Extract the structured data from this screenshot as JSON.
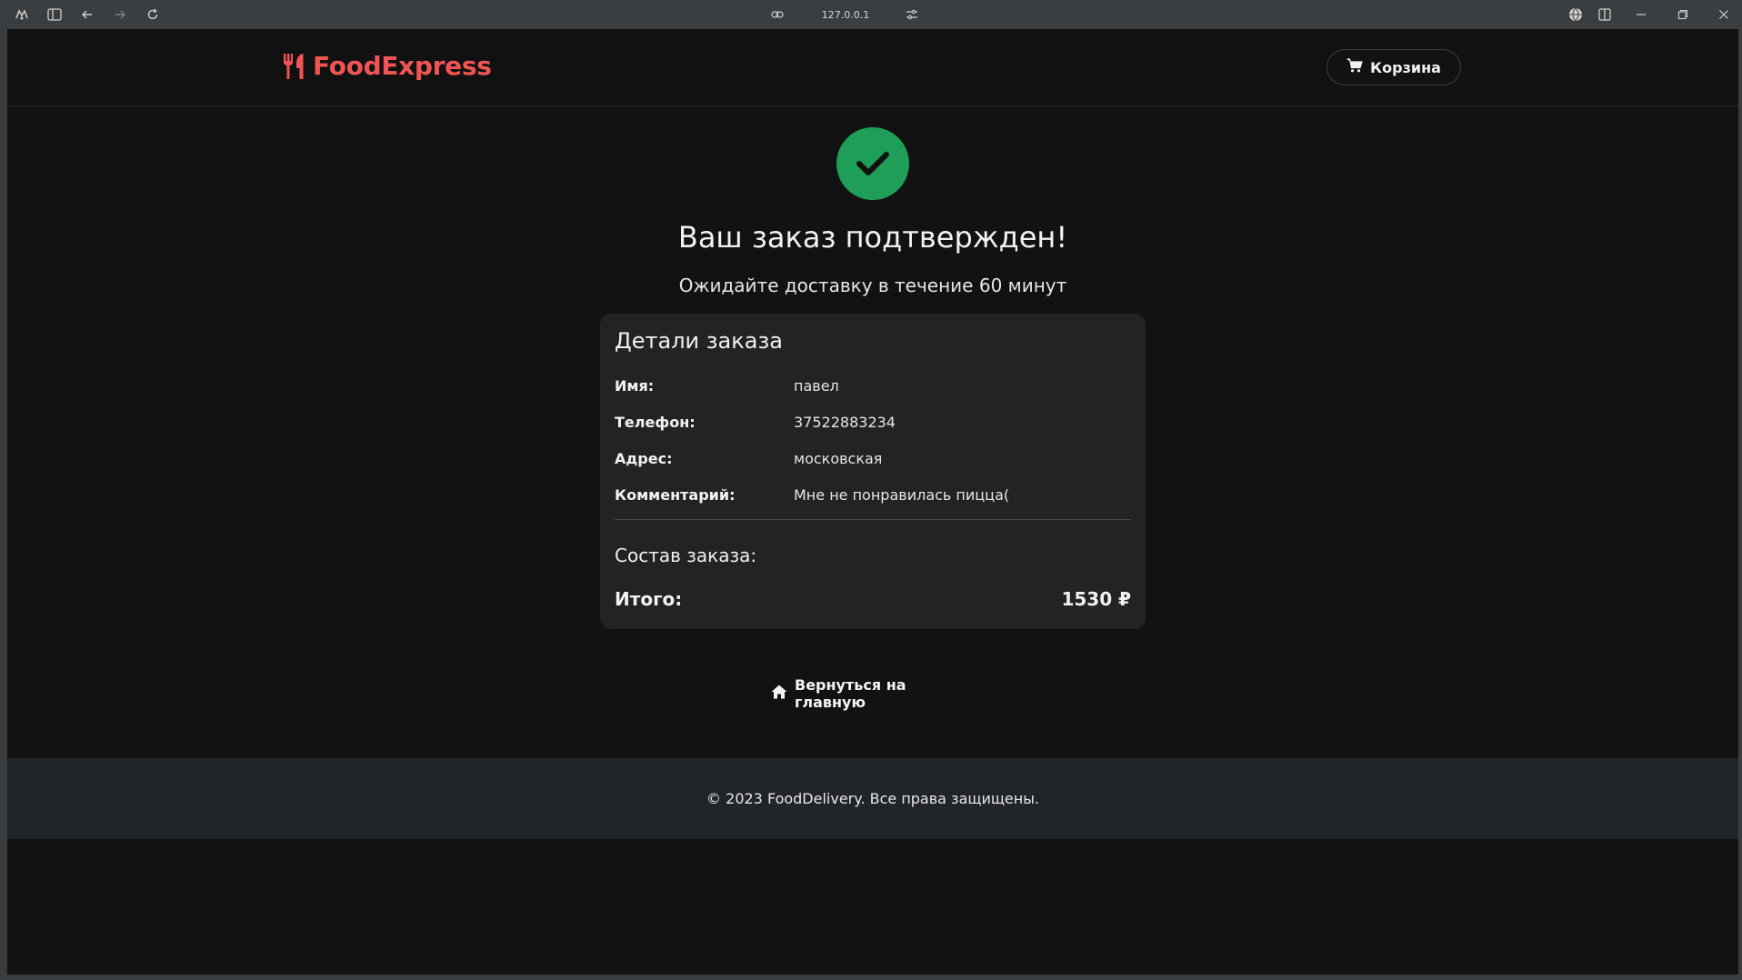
{
  "browser": {
    "url": "127.0.0.1",
    "icons": [
      "app-icon",
      "sidebar-icon",
      "back-icon",
      "forward-icon",
      "reload-icon",
      "link-icon",
      "settings-icon",
      "globe-icon",
      "split-icon",
      "minimize-icon",
      "restore-icon",
      "close-icon"
    ]
  },
  "header": {
    "brand": "FoodExpress",
    "brand_color": "#f05454",
    "cart_label": "Корзина"
  },
  "confirmation": {
    "title": "Ваш заказ подтвержден!",
    "subtitle": "Ожидайте доставку в течение 60 минут",
    "success_color": "#1e9e56"
  },
  "order": {
    "title": "Детали заказа",
    "fields": [
      {
        "label": "Имя:",
        "value": "павел"
      },
      {
        "label": "Телефон:",
        "value": "37522883234"
      },
      {
        "label": "Адрес:",
        "value": "московская"
      },
      {
        "label": "Комментарий:",
        "value": "Мне не понравилась пицца("
      }
    ],
    "composition_label": "Состав заказа:",
    "total_label": "Итого:",
    "total_value": "1530 ₽"
  },
  "home_link": "Вернуться на главную",
  "footer": {
    "text": "© 2023 FoodDelivery. Все права защищены."
  }
}
